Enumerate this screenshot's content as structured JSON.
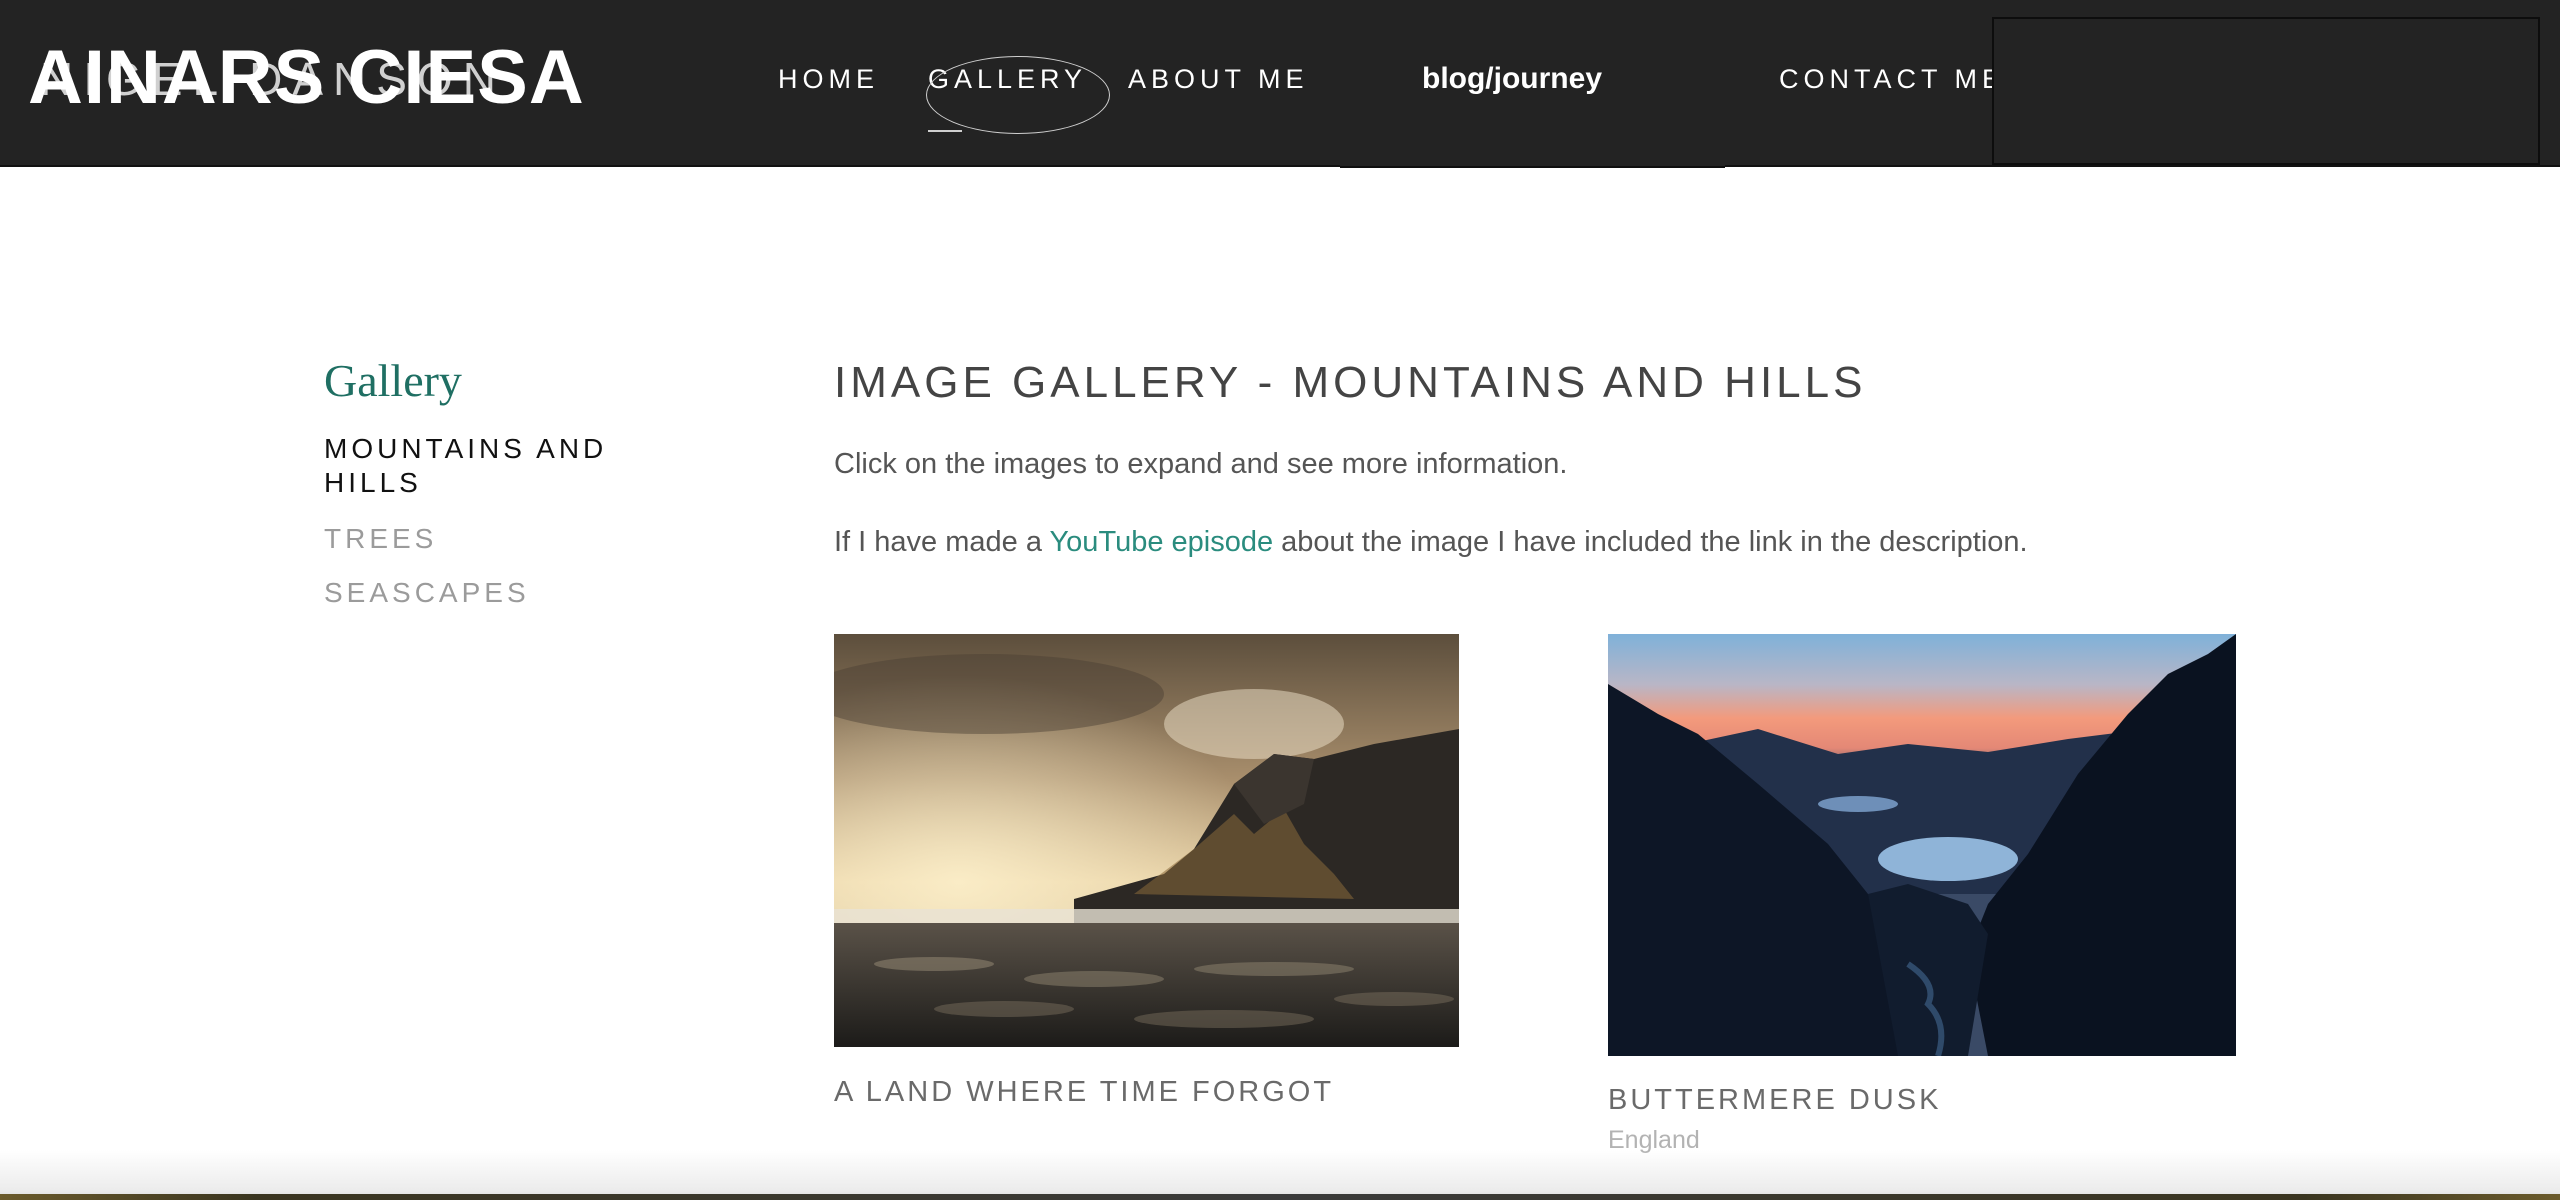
{
  "header": {
    "logo_text": "AINARS CIESA",
    "logo_ghost_text": "NIGEL DANSON",
    "nav": {
      "home": "HOME",
      "gallery": "GALLERY",
      "about": "ABOUT ME",
      "blog": "blog/journey",
      "contact": "CONTACT ME"
    },
    "background_color": "#232323"
  },
  "sidebar": {
    "title": "Gallery",
    "items": [
      {
        "label": "MOUNTAINS AND HILLS",
        "active": true
      },
      {
        "label": "TREES",
        "active": false
      },
      {
        "label": "SEASCAPES",
        "active": false
      }
    ],
    "accent_color": "#1f6f63"
  },
  "main": {
    "title": "IMAGE GALLERY - MOUNTAINS AND HILLS",
    "intro": "Click on the images to expand and see more information.",
    "youtube_pre": "If I have made a ",
    "youtube_link": "YouTube episode",
    "youtube_post": " about the image I have included the link in the description.",
    "link_color": "#2a8c7e",
    "images": [
      {
        "caption": "A LAND WHERE TIME FORGOT",
        "location": ""
      },
      {
        "caption": "BUTTERMERE DUSK",
        "location": "England"
      }
    ]
  }
}
